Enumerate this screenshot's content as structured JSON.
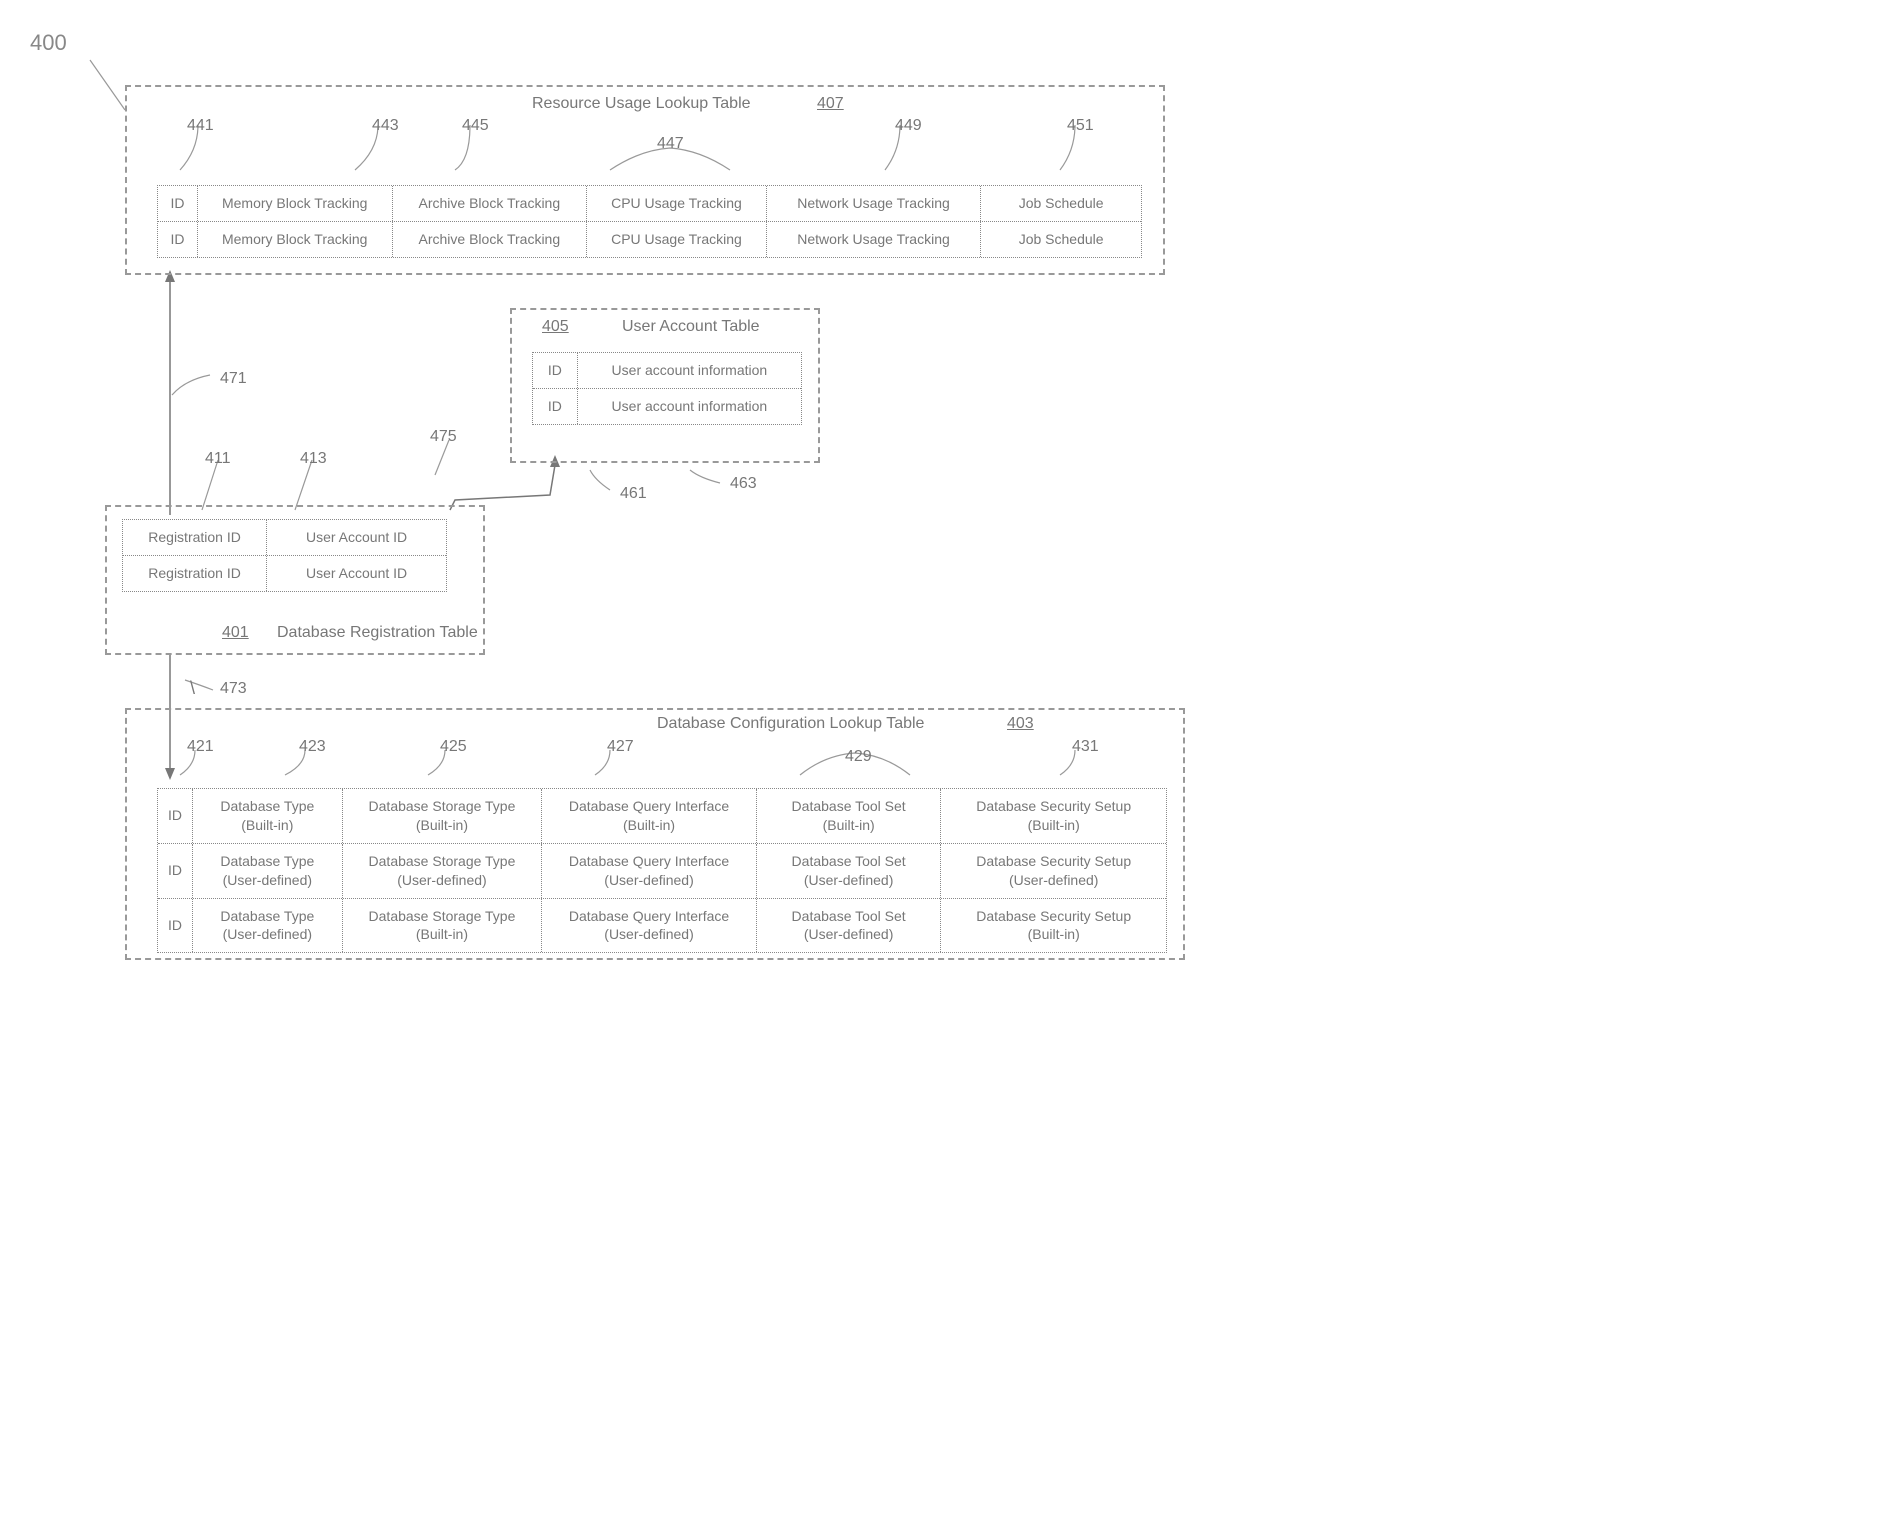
{
  "fig_label": "400",
  "resource_usage": {
    "ref": "407",
    "title": "Resource Usage Lookup Table",
    "col_refs": {
      "c1": "441",
      "c2": "443",
      "c3": "445",
      "c4": "447",
      "c5": "449",
      "c6": "451"
    },
    "cols": {
      "id": "ID",
      "mem": "Memory Block Tracking",
      "arch": "Archive Block Tracking",
      "cpu": "CPU Usage Tracking",
      "net": "Network Usage Tracking",
      "job": "Job Schedule"
    }
  },
  "user_account": {
    "ref": "405",
    "title": "User Account Table",
    "cols": {
      "id": "ID",
      "info": "User account information"
    },
    "row_refs": {
      "r1": "461",
      "r2": "463"
    }
  },
  "registration": {
    "ref": "401",
    "title": "Database Registration Table",
    "col_refs": {
      "c1": "411",
      "c2": "413"
    },
    "cols": {
      "reg": "Registration ID",
      "uid": "User Account ID"
    }
  },
  "db_config": {
    "ref": "403",
    "title": "Database Configuration Lookup Table",
    "col_refs": {
      "c1": "421",
      "c2": "423",
      "c3": "425",
      "c4": "427",
      "c5": "429",
      "c6": "431"
    },
    "cols": {
      "id": "ID",
      "type": "Database Type",
      "storage": "Database Storage Type",
      "query": "Database Query Interface",
      "tool": "Database Tool Set",
      "sec": "Database Security Setup"
    },
    "origins": {
      "builtin": "(Built-in)",
      "user": "(User-defined)"
    }
  },
  "arrows": {
    "a1": "471",
    "a2": "473",
    "a3": "475"
  },
  "backslash": "\\"
}
